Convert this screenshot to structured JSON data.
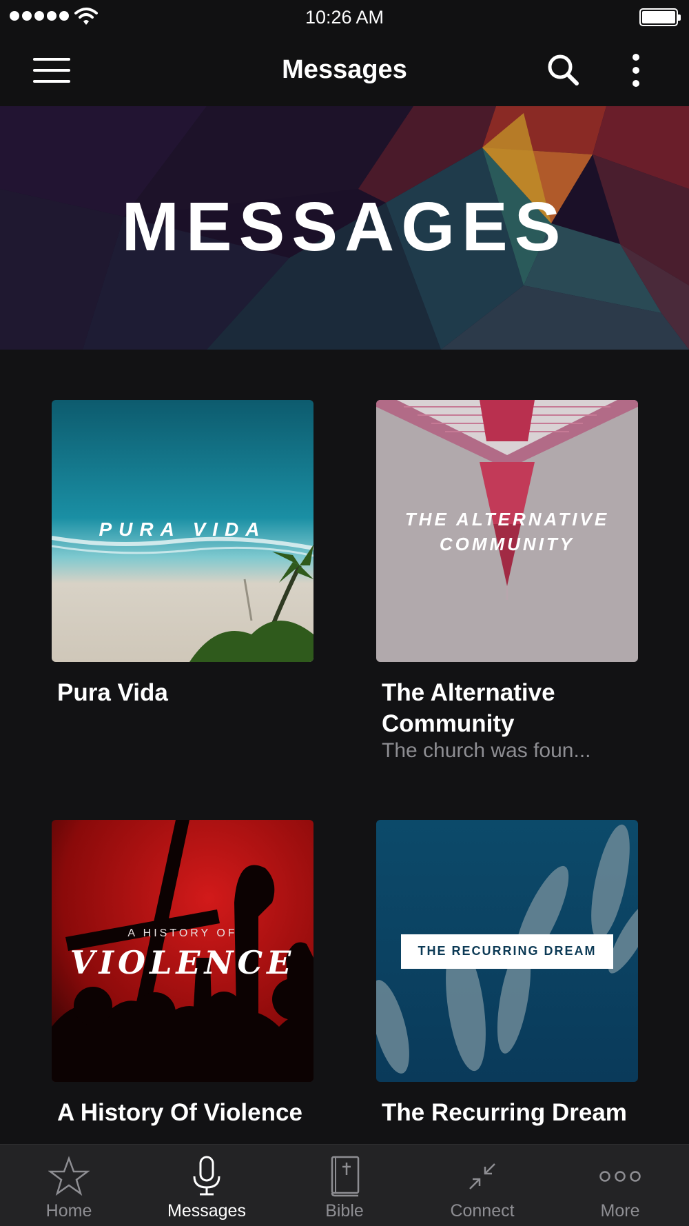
{
  "status_bar": {
    "time": "10:26 AM",
    "signal_icon": "signal-dots-icon",
    "wifi_icon": "wifi-icon",
    "battery_icon": "battery-icon"
  },
  "nav": {
    "title": "Messages",
    "menu_icon": "hamburger-menu-icon",
    "search_icon": "search-icon",
    "more_icon": "vertical-ellipsis-icon"
  },
  "banner": {
    "title": "MESSAGES"
  },
  "series": [
    {
      "title": "Pura Vida",
      "subtitle": "",
      "artwork_text": "PURA VIDA"
    },
    {
      "title": "The Alternative Community",
      "subtitle": "The church was foun...",
      "artwork_text_1": "THE ALTERNATIVE",
      "artwork_text_2": "COMMUNITY"
    },
    {
      "title": "A History Of Violence",
      "subtitle": "",
      "artwork_text_1": "A HISTORY OF",
      "artwork_text_2": "VIOLENCE"
    },
    {
      "title": "The Recurring Dream",
      "subtitle": "",
      "artwork_text": "THE RECURRING DREAM"
    }
  ],
  "tabs": [
    {
      "label": "Home",
      "icon": "star-icon",
      "active": false
    },
    {
      "label": "Messages",
      "icon": "microphone-icon",
      "active": true
    },
    {
      "label": "Bible",
      "icon": "bible-icon",
      "active": false
    },
    {
      "label": "Connect",
      "icon": "connect-arrows-icon",
      "active": false
    },
    {
      "label": "More",
      "icon": "more-dots-icon",
      "active": false
    }
  ],
  "colors": {
    "background": "#121214",
    "bar_background": "#111112",
    "tab_bar_background": "#232325",
    "inactive_tab": "#8e8e93",
    "active_tab": "#ffffff"
  }
}
